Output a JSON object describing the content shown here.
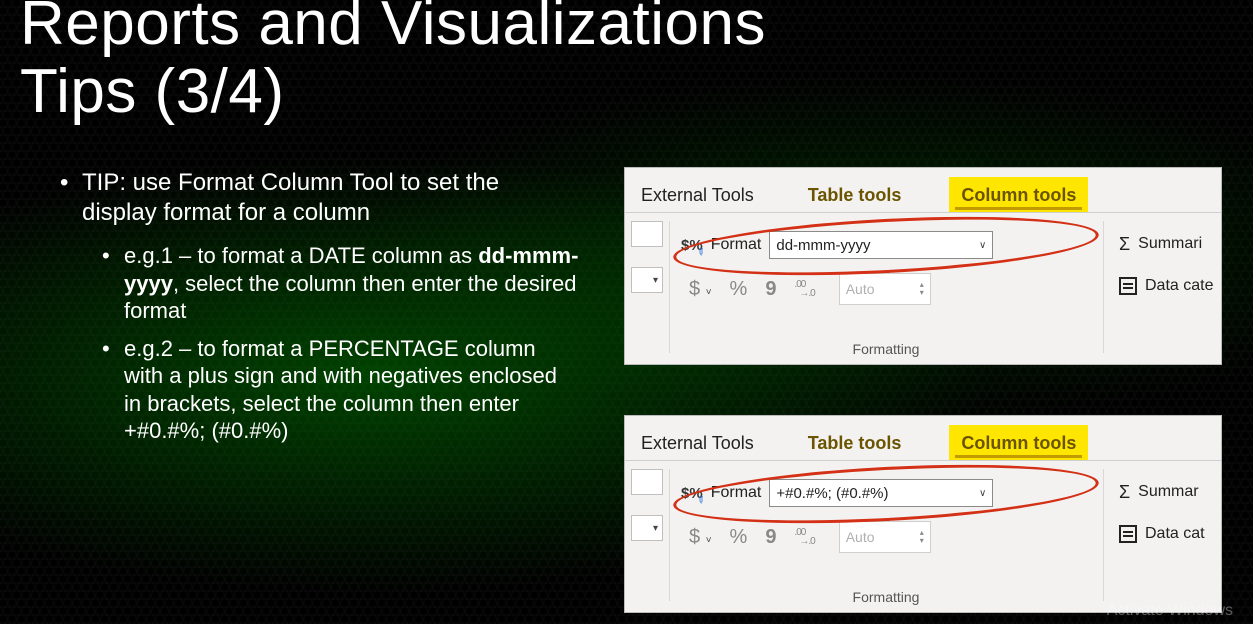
{
  "title_line1": "Reports and Visualizations",
  "title_line2": "Tips (3/4)",
  "tip_main": "TIP: use Format Column Tool to set the display format for a column",
  "eg1_prefix": "e.g.1 – to format a DATE column as ",
  "eg1_bold": "dd-mmm-yyyy",
  "eg1_suffix": ", select the column then enter the desired format",
  "eg2": "e.g.2 – to format a PERCENTAGE column with a plus sign and with negatives enclosed in brackets, select the column then enter +#0.#%; (#0.#%)",
  "ribbon": {
    "tab_external": "External Tools",
    "tab_table": "Table tools",
    "tab_column": "Column tools",
    "format_label": "Format",
    "format_value_1": "dd-mmm-yyyy",
    "format_value_2": "+#0.#%; (#0.#%)",
    "auto": "Auto",
    "group_label": "Formatting",
    "currency": "$",
    "percent": "%",
    "thousand": "9",
    "decimal": ".00→.0",
    "sigma": "Σ",
    "summarization": "Summari",
    "summarization2": "Summar",
    "data_cat": "Data cate",
    "data_cat2": "Data cat"
  },
  "watermark": "Activate Windows"
}
